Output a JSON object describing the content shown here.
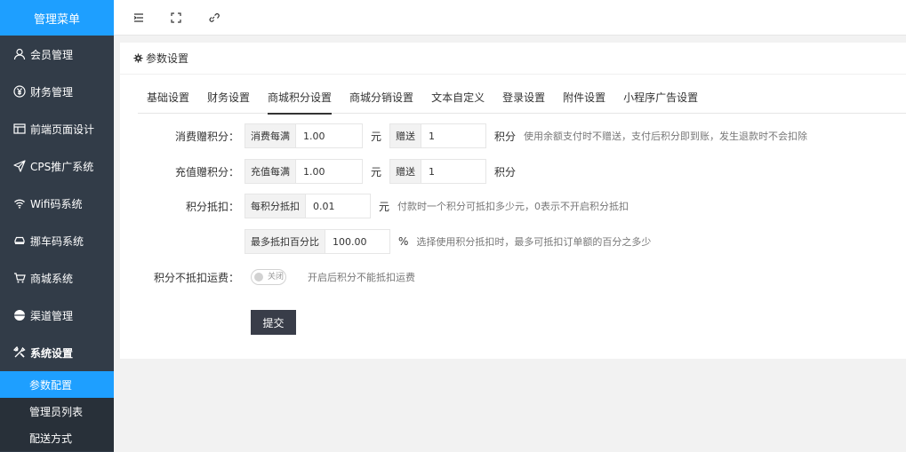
{
  "sidebar": {
    "title": "管理菜单",
    "items": [
      {
        "label": "会员管理",
        "icon": "user-icon"
      },
      {
        "label": "财务管理",
        "icon": "yen-icon"
      },
      {
        "label": "前端页面设计",
        "icon": "layout-icon"
      },
      {
        "label": "CPS推广系统",
        "icon": "send-icon"
      },
      {
        "label": "Wifi码系统",
        "icon": "wifi-icon"
      },
      {
        "label": "挪车码系统",
        "icon": "car-icon"
      },
      {
        "label": "商城系统",
        "icon": "cart-icon"
      },
      {
        "label": "渠道管理",
        "icon": "circle-icon"
      },
      {
        "label": "系统设置",
        "icon": "tools-icon"
      }
    ],
    "submenu": [
      {
        "label": "参数配置",
        "active": true
      },
      {
        "label": "管理员列表",
        "active": false
      },
      {
        "label": "配送方式",
        "active": false
      }
    ]
  },
  "topbar": {
    "icons": [
      "menu-fold-icon",
      "fullscreen-icon",
      "link-icon"
    ]
  },
  "card": {
    "title": "参数设置",
    "tabs": [
      "基础设置",
      "财务设置",
      "商城积分设置",
      "商城分销设置",
      "文本自定义",
      "登录设置",
      "附件设置",
      "小程序广告设置"
    ],
    "active_tab": "商城积分设置"
  },
  "form": {
    "consume": {
      "label": "消费赠积分：",
      "prefix1": "消费每满",
      "value1": "1.00",
      "unit1": "元",
      "prefix2": "赠送",
      "value2": "1",
      "unit2": "积分",
      "hint": "使用余额支付时不赠送，支付后积分即到账，发生退款时不会扣除"
    },
    "recharge": {
      "label": "充值赠积分：",
      "prefix1": "充值每满",
      "value1": "1.00",
      "unit1": "元",
      "prefix2": "赠送",
      "value2": "1",
      "unit2": "积分"
    },
    "deduct": {
      "label": "积分抵扣：",
      "prefix": "每积分抵扣",
      "value": "0.01",
      "unit": "元",
      "hint": "付款时一个积分可抵扣多少元，0表示不开启积分抵扣"
    },
    "max_deduct": {
      "prefix": "最多抵扣百分比",
      "value": "100.00",
      "unit": "%",
      "hint": "选择使用积分抵扣时，最多可抵扣订单额的百分之多少"
    },
    "freight": {
      "label": "积分不抵扣运费：",
      "switch_text": "关闭",
      "hint": "开启后积分不能抵扣运费"
    },
    "submit_label": "提交"
  },
  "colors": {
    "sidebar_bg": "#323c48",
    "accent": "#1e9fff",
    "button": "#393d49"
  }
}
